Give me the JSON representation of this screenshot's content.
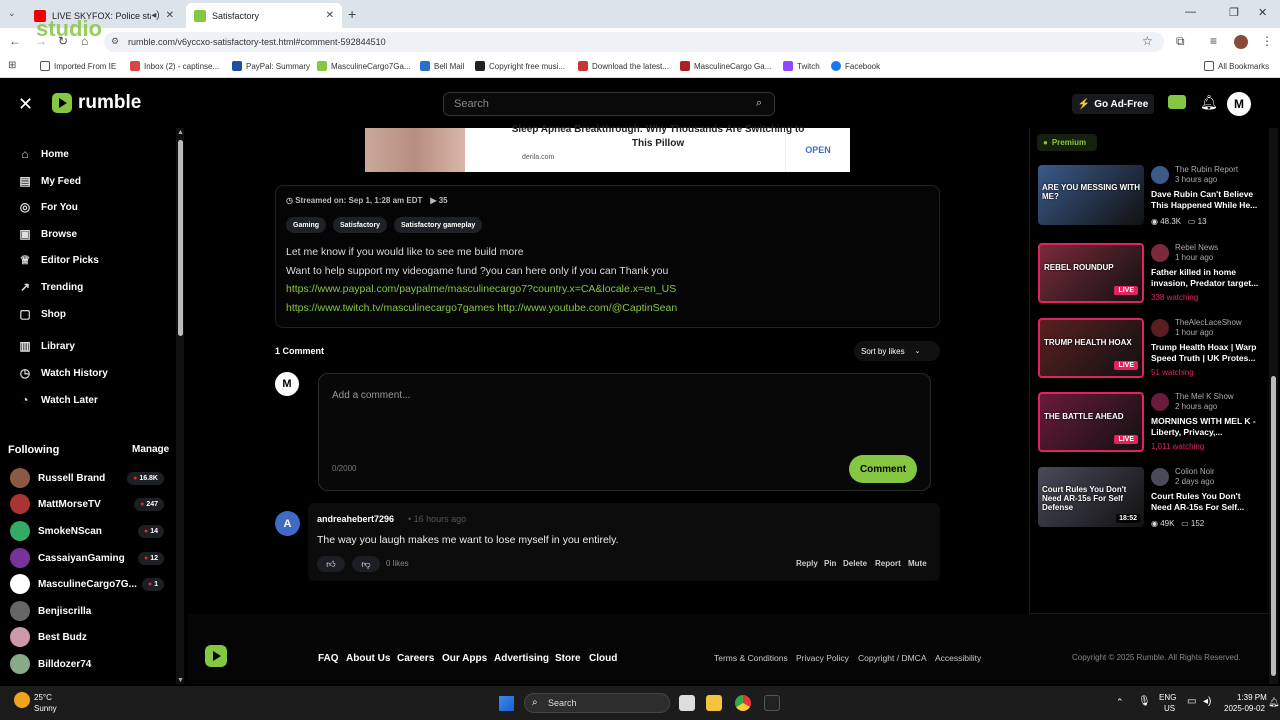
{
  "browser": {
    "tabs": [
      {
        "label": "LIVE SKYFOX: Police standoff"
      },
      {
        "label": "Satisfactory"
      }
    ],
    "url": "rumble.com/v6yccxo-satisfactory-test.html#comment-592844510",
    "bookmarks": [
      "Imported From IE",
      "Inbox (2) - captinse...",
      "PayPal: Summary",
      "MasculineCargo7Ga...",
      "Bell Mail",
      "Copyright free musi...",
      "Download the latest...",
      "MasculineCargo Ga...",
      "Twitch",
      "Facebook"
    ],
    "all_bookmarks": "All Bookmarks"
  },
  "watermark": "studio",
  "header": {
    "logo_text": "rumble",
    "search_placeholder": "Search",
    "go_ad_free": "Go Ad-Free",
    "avatar_letter": "M"
  },
  "sidebar": {
    "nav": [
      {
        "label": "Home",
        "icon": "⌂"
      },
      {
        "label": "My Feed",
        "icon": "▤"
      },
      {
        "label": "For You",
        "icon": "◎"
      },
      {
        "label": "Browse",
        "icon": "▣"
      },
      {
        "label": "Editor Picks",
        "icon": "♕"
      },
      {
        "label": "Trending",
        "icon": "↗"
      },
      {
        "label": "Shop",
        "icon": "▢"
      },
      {
        "label": "Library",
        "icon": "▥"
      },
      {
        "label": "Watch History",
        "icon": "◷"
      },
      {
        "label": "Watch Later",
        "icon": "◔"
      }
    ],
    "following_title": "Following",
    "manage": "Manage",
    "following": [
      {
        "name": "Russell Brand",
        "count": "16.8K",
        "color": "#8a5a44"
      },
      {
        "name": "MattMorseTV",
        "count": "247",
        "color": "#a33"
      },
      {
        "name": "SmokeNScan",
        "count": "14",
        "color": "#3a6"
      },
      {
        "name": "CassaiyanGaming",
        "count": "12",
        "color": "#739"
      },
      {
        "name": "MasculineCargo7G...",
        "count": "1",
        "color": "#fff"
      },
      {
        "name": "Benjiscrilla",
        "count": "",
        "color": "#666"
      },
      {
        "name": "Best Budz",
        "count": "",
        "color": "#c9a"
      },
      {
        "name": "Billdozer74",
        "count": "",
        "color": "#8a8"
      }
    ]
  },
  "ad": {
    "title": "Sleep Apnea Breakthrough: Why Thousands Are Switching to This Pillow",
    "domain": "derila.com",
    "open": "OPEN"
  },
  "video": {
    "streamed": "Streamed on: Sep 1, 1:28 am EDT",
    "views": "35",
    "tags": [
      "Gaming",
      "Satisfactory",
      "Satisfactory gameplay"
    ],
    "desc_line1": "Let me know if you would like to see me build more",
    "desc_line2": "Want to help support my videogame fund ?you can here only if you can Thank you",
    "link1": "https://www.paypal.com/paypalme/masculinecargo7?country.x=CA&locale.x=en_US",
    "link2": "https://www.twitch.tv/masculinecargo7games",
    "link3": "http://www.youtube.com/@CaptinSean"
  },
  "comments": {
    "count_label": "1 Comment",
    "sort_label": "Sort by likes",
    "my_avatar": "M",
    "placeholder": "Add a comment...",
    "char_count": "0/2000",
    "comment_button": "Comment",
    "items": [
      {
        "avatar": "A",
        "user": "andreahebert7296",
        "time": "• 16 hours ago",
        "text": "The way you laugh makes me want to lose myself in you entirely.",
        "likes": "0 likes",
        "actions": [
          "Reply",
          "Pin",
          "Delete",
          "Report",
          "Mute"
        ]
      }
    ]
  },
  "right": {
    "premium": "Premium",
    "videos": [
      {
        "channel": "The Rubin Report",
        "time": "3 hours ago",
        "title": "Dave Rubin Can't Believe This Happened While He...",
        "views": "48.3K",
        "comments": "13",
        "live": false,
        "thumb_text": "ARE YOU MESSING WITH ME?",
        "color": "#3a5a8a"
      },
      {
        "channel": "Rebel News",
        "time": "1 hour ago",
        "title": "Father killed in home invasion, Predator target...",
        "watching": "338 watching",
        "live": true,
        "thumb_text": "REBEL ROUNDUP",
        "color": "#7a2a3a"
      },
      {
        "channel": "TheAlecLaceShow",
        "time": "1 hour ago",
        "title": "Trump Health Hoax | Warp Speed Truth | UK Protes...",
        "watching": "51 watching",
        "live": true,
        "thumb_text": "TRUMP HEALTH HOAX",
        "color": "#5a2020"
      },
      {
        "channel": "The Mel K Show",
        "time": "2 hours ago",
        "title": "MORNINGS WITH MEL K - Liberty, Privacy,...",
        "watching": "1,011 watching",
        "live": true,
        "thumb_text": "THE BATTLE AHEAD",
        "color": "#6a1a3a"
      },
      {
        "channel": "Colion Noir",
        "time": "2 days ago",
        "title": "Court Rules You Don't Need AR-15s For Self...",
        "views": "49K",
        "comments": "152",
        "live": false,
        "duration": "18:52",
        "thumb_text": "Court Rules You Don't Need AR-15s For Self Defense",
        "color": "#4a4a5a"
      }
    ],
    "live_label": "LIVE"
  },
  "footer": {
    "links": [
      "FAQ",
      "About Us",
      "Careers",
      "Our Apps",
      "Advertising",
      "Store",
      "Cloud"
    ],
    "legal": [
      "Terms & Conditions",
      "Privacy Policy",
      "Copyright / DMCA",
      "Accessibility"
    ],
    "copyright": "Copyright © 2025 Rumble. All Rights Reserved."
  },
  "taskbar": {
    "temp": "25°C",
    "condition": "Sunny",
    "search": "Search",
    "lang1": "ENG",
    "lang2": "US",
    "time": "1:39 PM",
    "date": "2025-09-02"
  }
}
